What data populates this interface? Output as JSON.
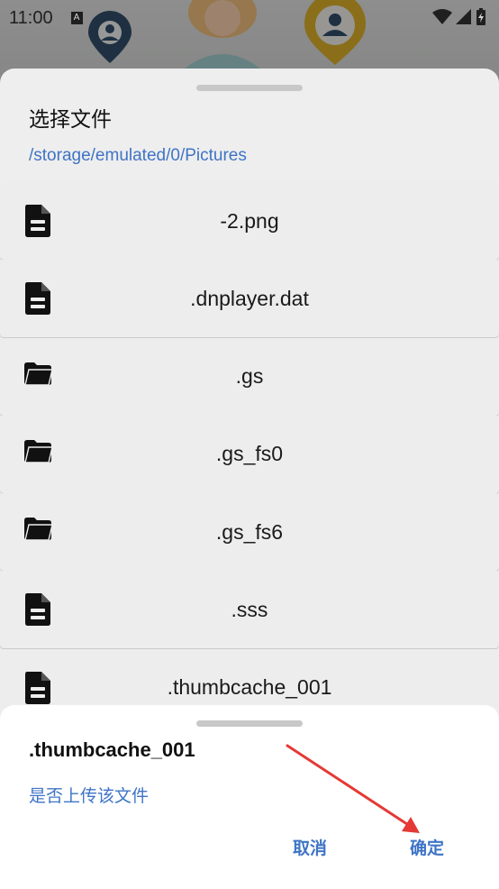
{
  "status_bar": {
    "time": "11:00",
    "icons": [
      "a-notification-icon",
      "wifi-icon",
      "signal-icon",
      "battery-icon"
    ],
    "glyph_a": "A"
  },
  "file_picker": {
    "title": "选择文件",
    "path": "/storage/emulated/0/Pictures",
    "items": [
      {
        "name": "-2.png",
        "type": "file"
      },
      {
        "name": ".dnplayer.dat",
        "type": "file"
      },
      {
        "name": ".gs",
        "type": "folder"
      },
      {
        "name": ".gs_fs0",
        "type": "folder"
      },
      {
        "name": ".gs_fs6",
        "type": "folder"
      },
      {
        "name": ".sss",
        "type": "file"
      },
      {
        "name": ".thumbcache_001",
        "type": "file"
      }
    ]
  },
  "confirm_dialog": {
    "title": ".thumbcache_001",
    "message": "是否上传该文件",
    "cancel_label": "取消",
    "ok_label": "确定"
  },
  "colors": {
    "accent": "#3f74c6",
    "sheet_bg": "#eeeeee",
    "dialog_bg": "#ffffff",
    "annotation_arrow": "#e53935"
  }
}
